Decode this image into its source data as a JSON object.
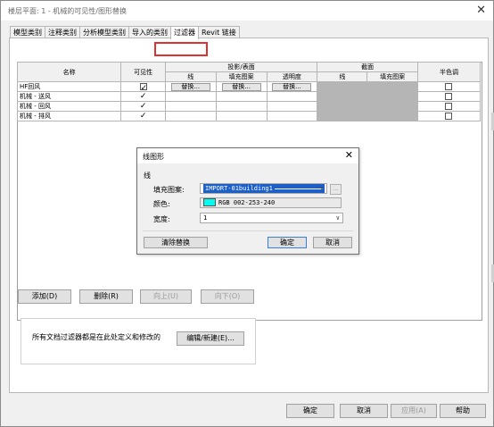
{
  "window": {
    "title": "楼层平面: 1 - 机械的可见性/图形替换",
    "close": "✕"
  },
  "tabs": [
    "模型类别",
    "注释类别",
    "分析模型类别",
    "导入的类别",
    "过滤器",
    "Revit 链接"
  ],
  "table": {
    "headers": {
      "name": "名称",
      "visibility": "可见性",
      "projection": "投影/表面",
      "projection_sub": [
        "线",
        "填充图案",
        "透明度"
      ],
      "cut": "截面",
      "cut_sub": [
        "线",
        "填充图案"
      ],
      "halftone": "半色调"
    },
    "override_label": "替换...",
    "rows": [
      {
        "name": "HF回风",
        "visible": true,
        "halftone": false
      },
      {
        "name": "机械 - 送风",
        "visible": true,
        "halftone": false
      },
      {
        "name": "机械 - 回风",
        "visible": true,
        "halftone": false
      },
      {
        "name": "机械 - 排风",
        "visible": true,
        "halftone": false
      }
    ]
  },
  "buttons": {
    "add": "添加(D)",
    "remove": "删除(R)",
    "up": "向上(U)",
    "down": "向下(O)",
    "edit_new": "编辑/新建(E)..."
  },
  "info_text": "所有文档过滤器都是在此处定义和修改的",
  "footer": {
    "ok": "确定",
    "cancel": "取消",
    "apply": "应用(A)",
    "help": "帮助"
  },
  "dialog": {
    "title": "线图形",
    "close": "✕",
    "group": "线",
    "pattern_label": "填充图案:",
    "pattern_value": "IMPORT-01building1",
    "color_label": "颜色:",
    "color_value": "RGB 002-253-240",
    "color_hex": "#02fdf0",
    "weight_label": "宽度:",
    "weight_value": "1",
    "ellipsis": "...",
    "clear_button": "清除替换",
    "ok_button": "确定",
    "cancel_button": "取消"
  }
}
